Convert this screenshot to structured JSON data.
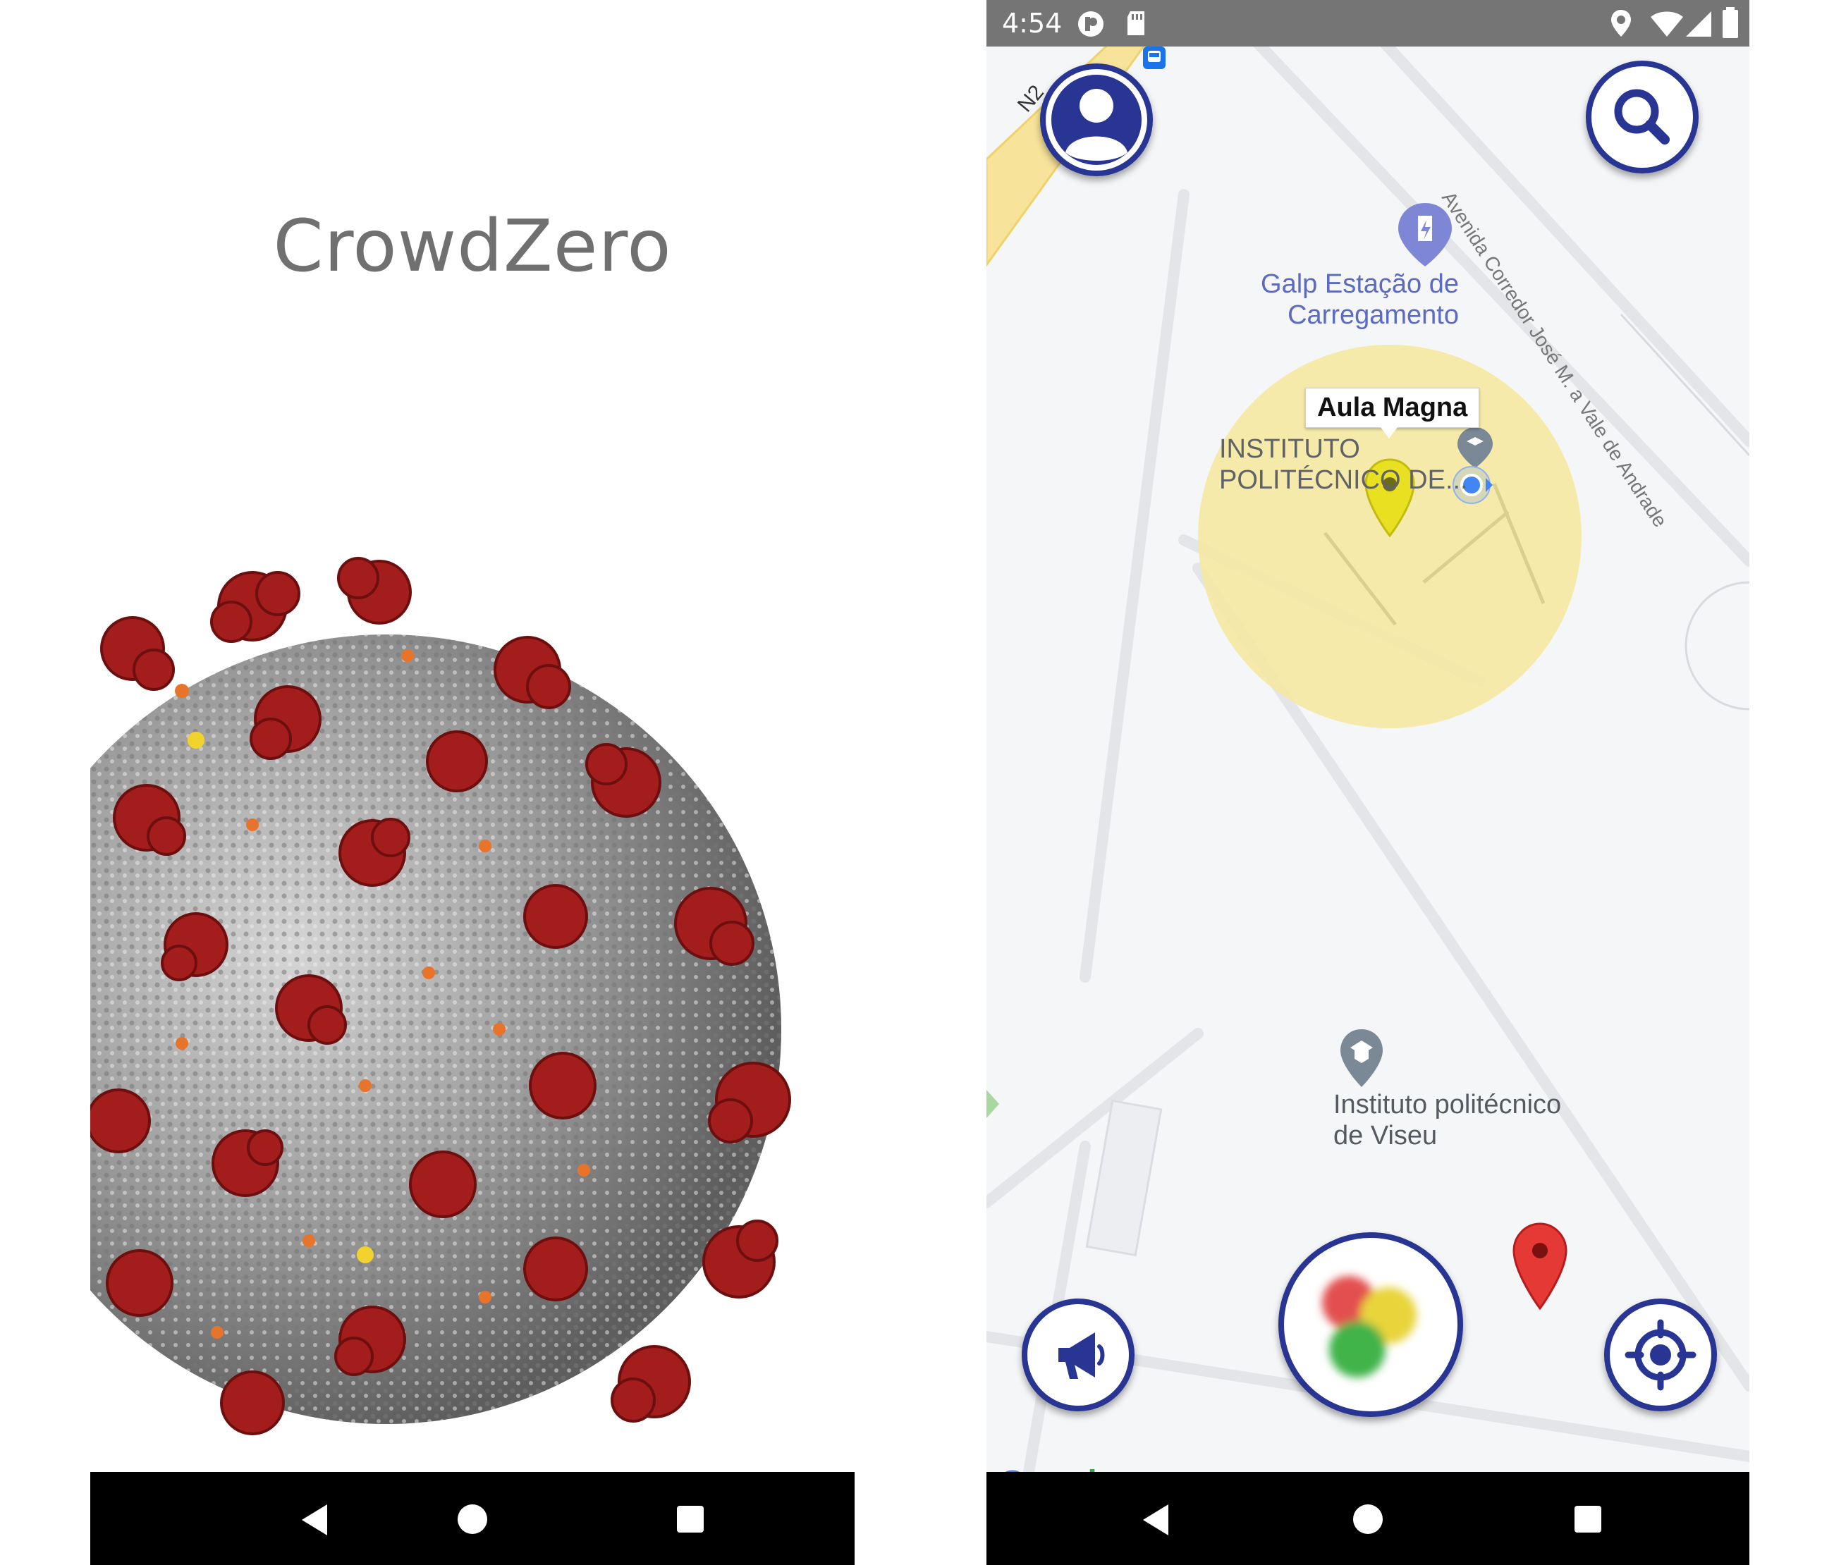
{
  "splash": {
    "title": "CrowdZero",
    "image": "coronavirus-illustration",
    "nav": {
      "back": "back-icon",
      "home": "home-icon",
      "recent": "recents-icon"
    }
  },
  "map_screen": {
    "status_bar": {
      "time": "4:54",
      "left_icons": [
        "app-notification-icon",
        "sd-card-icon"
      ],
      "right_icons": [
        "location-icon",
        "wifi-icon",
        "signal-icon",
        "battery-icon"
      ]
    },
    "map": {
      "road_label": "N2",
      "street_label": "Avenida Corredor José M. a Vale de Andrade",
      "poi_ev_station": "Galp Estação de\nCarregamento",
      "poi_institute_building": "INSTITUTO\nPOLITÉCNICO DE...",
      "poi_ipv": "Instituto politécnico\nde Viseu",
      "selected_marker_title": "Aula Magna",
      "attribution": "Google"
    },
    "buttons": {
      "profile": "profile-button",
      "search": "search-button",
      "report": "megaphone-button",
      "traffic": "traffic-light-button",
      "locate": "my-location-button"
    },
    "colors": {
      "accent": "#283593",
      "zone_fill": "#f6e79e",
      "marker_selected": "#e8e020",
      "marker_red": "#e53935",
      "status_bar": "#757575"
    },
    "nav": {
      "back": "back-icon",
      "home": "home-icon",
      "recent": "recents-icon"
    }
  }
}
